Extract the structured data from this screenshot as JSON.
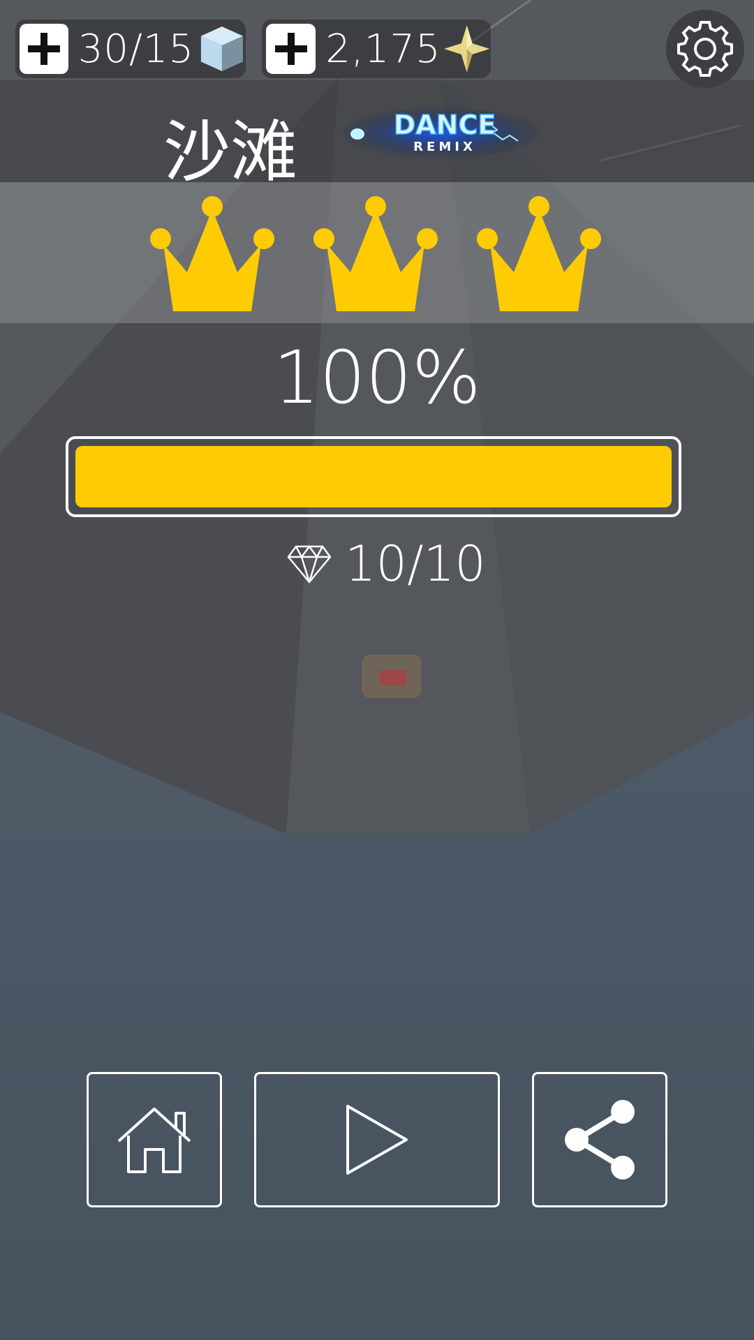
{
  "hud": {
    "cubes_value": "30/15",
    "stars_value": "2,175"
  },
  "level": {
    "title": "沙滩",
    "logo_text": "DANCE",
    "logo_subtext": "REMIX"
  },
  "result": {
    "crowns_earned": 3,
    "crowns_total": 3,
    "percent_label": "100%",
    "progress_fraction": 1.0,
    "gems_label": "10/10"
  },
  "icons": {
    "add_cubes": "plus-icon",
    "cubes": "cube-icon",
    "add_stars": "plus-icon",
    "stars": "star-icon",
    "settings": "gear-icon",
    "crown": "crown-icon",
    "gem": "diamond-icon",
    "home": "home-icon",
    "play": "play-icon",
    "share": "share-icon"
  },
  "colors": {
    "accent_yellow": "#ffcb05",
    "text": "#ffffff"
  }
}
